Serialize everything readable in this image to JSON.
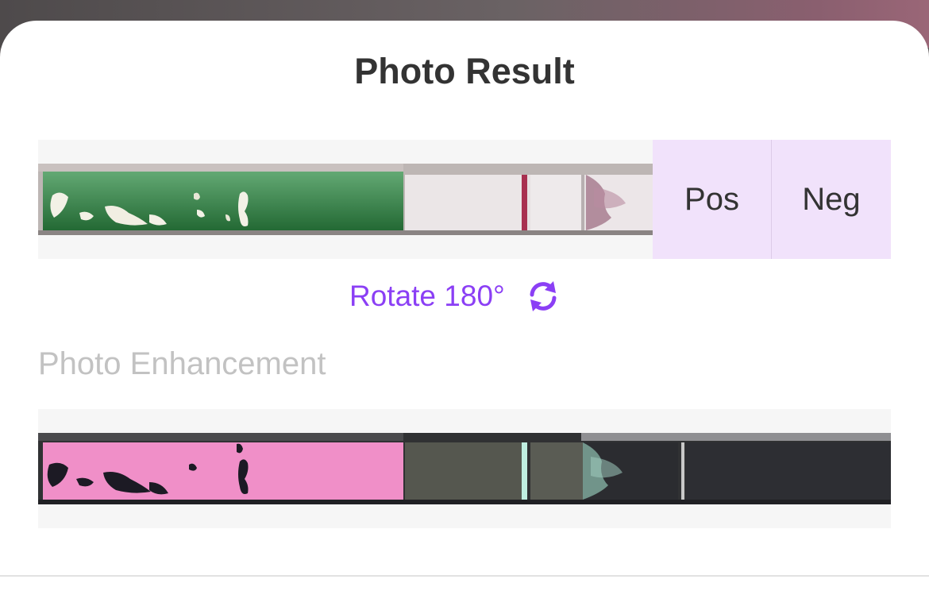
{
  "sheet": {
    "title": "Photo Result"
  },
  "result_panel": {
    "positive_label": "Pos",
    "negative_label": "Neg"
  },
  "rotate": {
    "label": "Rotate 180°",
    "icon": "rotate-icon"
  },
  "enhancement": {
    "section_label": "Photo Enhancement"
  },
  "colors": {
    "accent": "#8b3ff5",
    "choice_bg": "#f1e2fb",
    "strip_green": "#2e8b45",
    "strip_pink": "#f08fc8",
    "control_line": "#a0204e"
  }
}
